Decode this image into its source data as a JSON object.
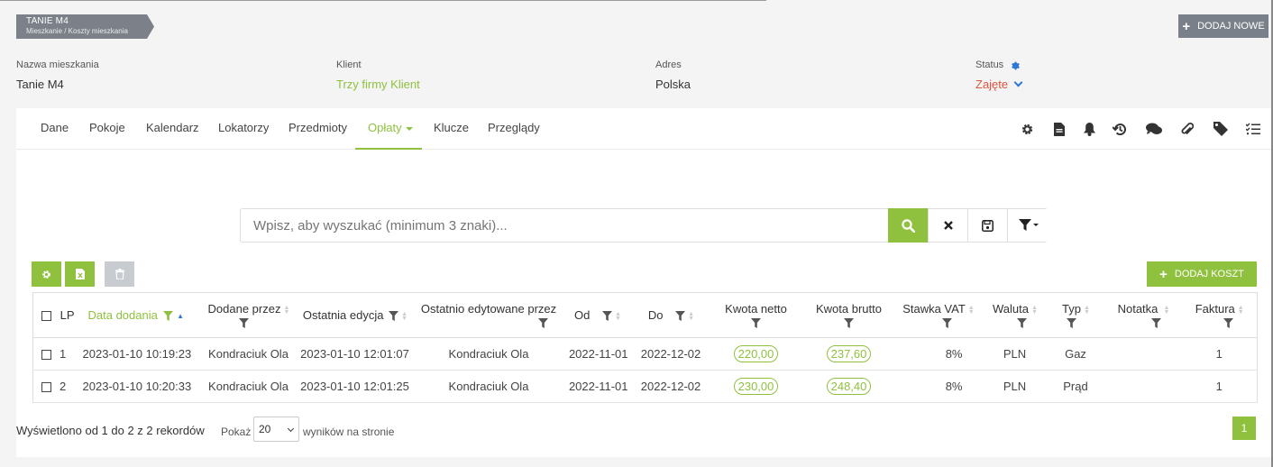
{
  "breadcrumb": {
    "title": "TANIE M4",
    "path": "Mieszkanie / Koszty mieszkania"
  },
  "add_new_label": "DODAJ NOWE",
  "info": {
    "name_label": "Nazwa mieszkania",
    "name_value": "Tanie M4",
    "client_label": "Klient",
    "client_value": "Trzy firmy Klient",
    "address_label": "Adres",
    "address_value": "Polska",
    "status_label": "Status",
    "status_value": "Zajęte"
  },
  "tabs": [
    {
      "label": "Dane"
    },
    {
      "label": "Pokoje"
    },
    {
      "label": "Kalendarz"
    },
    {
      "label": "Lokatorzy"
    },
    {
      "label": "Przedmioty"
    },
    {
      "label": "Opłaty"
    },
    {
      "label": "Klucze"
    },
    {
      "label": "Przeglądy"
    }
  ],
  "active_tab": "Opłaty",
  "toolbar_icons": [
    "gear-icon",
    "document-icon",
    "bell-icon",
    "history-icon",
    "comments-icon",
    "paperclip-icon",
    "tag-icon",
    "tasks-icon"
  ],
  "search": {
    "placeholder": "Wpisz, aby wyszukać (minimum 3 znaki)..."
  },
  "add_cost_label": "DODAJ KOSZT",
  "table": {
    "columns": [
      "LP",
      "Data dodania",
      "Dodane przez",
      "Ostatnia edycja",
      "Ostatnio edytowane przez",
      "Od",
      "Do",
      "Kwota netto",
      "Kwota brutto",
      "Stawka VAT",
      "Waluta",
      "Typ",
      "Notatka",
      "Faktura"
    ],
    "rows": [
      {
        "lp": "1",
        "added": "2023-01-10 10:19:23",
        "added_by": "Kondraciuk Ola",
        "last_edit": "2023-01-10 12:01:07",
        "edited_by": "Kondraciuk Ola",
        "from": "2022-11-01",
        "to": "2022-12-02",
        "net": "220,00",
        "gross": "237,60",
        "vat": "8%",
        "currency": "PLN",
        "type": "Gaz",
        "note": "",
        "invoice": "1"
      },
      {
        "lp": "2",
        "added": "2023-01-10 10:20:33",
        "added_by": "Kondraciuk Ola",
        "last_edit": "2023-01-10 12:01:25",
        "edited_by": "Kondraciuk Ola",
        "from": "2022-11-01",
        "to": "2022-12-02",
        "net": "230,00",
        "gross": "248,40",
        "vat": "8%",
        "currency": "PLN",
        "type": "Prąd",
        "note": "",
        "invoice": "1"
      }
    ]
  },
  "footer": {
    "summary": "Wyświetlono od 1 do 2 z 2 rekordów",
    "show_label": "Pokaż",
    "page_size": "20",
    "per_page_label": "wyników na stronie",
    "current_page": "1"
  },
  "colors": {
    "accent": "#8fc13f",
    "status_red": "#e0533d",
    "blue": "#2f77d6"
  }
}
